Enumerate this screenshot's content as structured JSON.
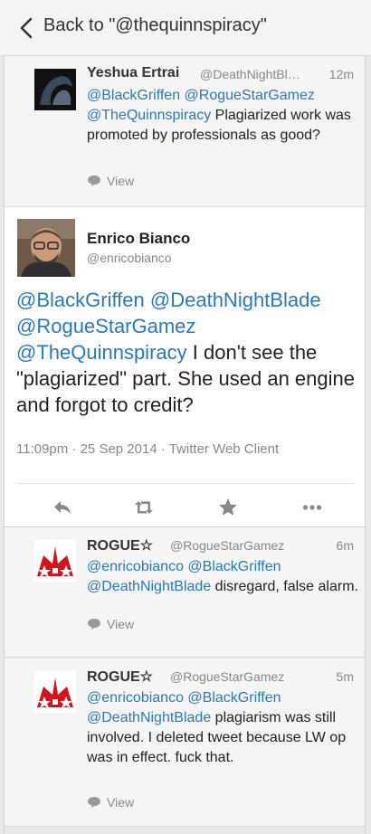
{
  "nav": {
    "back_label": "Back to \"@thequinnspiracy\""
  },
  "reply1": {
    "name": "Yeshua Ertrai",
    "handle": "@DeathNightBl…",
    "time": "12m",
    "mentions": [
      "@BlackGriffen",
      "@RogueStarGamez",
      "@TheQuinnspiracy"
    ],
    "text": "Plagiarized work was promoted by professionals as good?",
    "view_label": "View"
  },
  "main": {
    "name": "Enrico Bianco",
    "handle": "@enricobianco",
    "mentions": [
      "@BlackGriffen",
      "@DeathNightBlade",
      "@RogueStarGamez",
      "@TheQuinnspiracy"
    ],
    "text": "I don't see the \"plagiarized\" part. She used an engine and forgot to credit?",
    "meta": "11:09pm · 25 Sep 2014 · Twitter Web Client",
    "actions": [
      "reply-icon",
      "retweet-icon",
      "favorite-icon",
      "more-icon"
    ]
  },
  "reply2": {
    "name": "ROGUE☆",
    "handle": "@RogueStarGamez",
    "time": "6m",
    "mentions": [
      "@enricobianco",
      "@BlackGriffen",
      "@DeathNightBlade"
    ],
    "text": "disregard, false alarm.",
    "view_label": "View"
  },
  "reply3": {
    "name": "ROGUE☆",
    "handle": "@RogueStarGamez",
    "time": "5m",
    "mentions": [
      "@enricobianco",
      "@BlackGriffen",
      "@DeathNightBlade"
    ],
    "text": "plagiarism was still involved. I deleted tweet because LW op was in effect. fuck that.",
    "view_label": "View"
  },
  "colors": {
    "link": "#2a7ab7",
    "muted": "#888888",
    "background": "#e9e9e9"
  }
}
